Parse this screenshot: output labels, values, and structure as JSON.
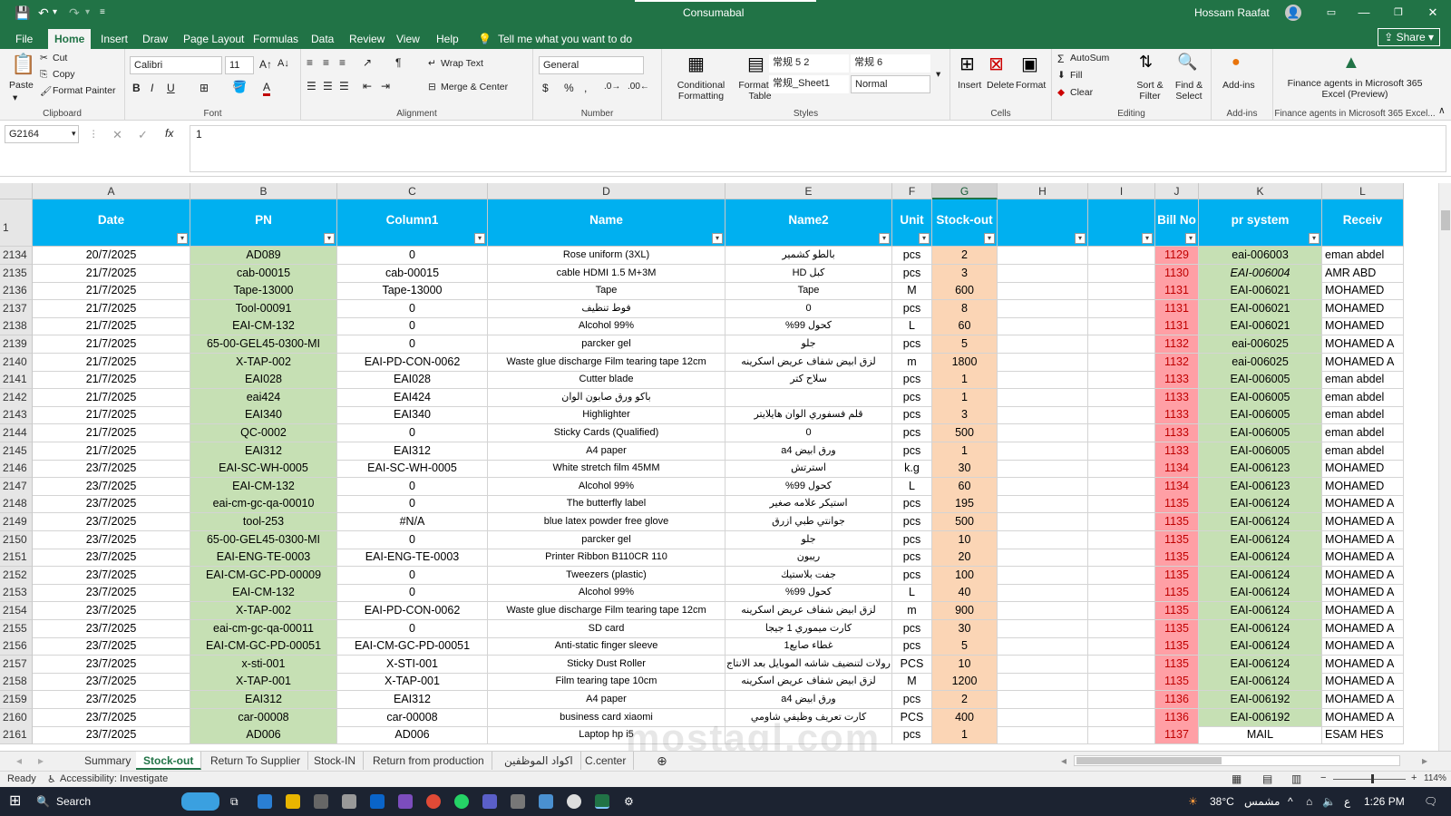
{
  "window": {
    "title": "Consumabal",
    "user": "Hossam Raafat"
  },
  "ribbon_tabs": [
    "File",
    "Home",
    "Insert",
    "Draw",
    "Page Layout",
    "Formulas",
    "Data",
    "Review",
    "View",
    "Help"
  ],
  "tell_me": "Tell me what you want to do",
  "share_label": "Share",
  "ribbon": {
    "clipboard": {
      "paste": "Paste",
      "cut": "Cut",
      "copy": "Copy",
      "format_painter": "Format Painter",
      "label": "Clipboard"
    },
    "font": {
      "name": "Calibri",
      "size": "11",
      "label": "Font"
    },
    "alignment": {
      "wrap": "Wrap Text",
      "merge": "Merge & Center",
      "label": "Alignment"
    },
    "number": {
      "format": "General",
      "label": "Number"
    },
    "styles": {
      "cond": "Conditional Formatting",
      "fmt_table": "Format as Table",
      "s1": "常规 5 2",
      "s2": "常规 6",
      "s3": "常规_Sheet1",
      "s4": "Normal",
      "label": "Styles"
    },
    "cells": {
      "insert": "Insert",
      "delete": "Delete",
      "format": "Format",
      "label": "Cells"
    },
    "editing": {
      "autosum": "AutoSum",
      "fill": "Fill",
      "clear": "Clear",
      "sort": "Sort & Filter",
      "find": "Find & Select",
      "label": "Editing"
    },
    "addins": {
      "addins": "Add-ins",
      "label": "Add-ins"
    },
    "finance": {
      "text": "Finance agents in Microsoft 365 Excel (Preview)",
      "label": "Finance agents in Microsoft 365 Excel..."
    }
  },
  "formula_bar": {
    "name_box": "G2164",
    "value": "1"
  },
  "columns": [
    "A",
    "B",
    "C",
    "D",
    "E",
    "F",
    "G",
    "H",
    "I",
    "J",
    "K",
    "L"
  ],
  "header_row_num": "1",
  "headers": [
    "Date",
    "PN",
    "Column1",
    "Name",
    "Name2",
    "Unit",
    "Stock-out",
    "",
    "",
    "Bill No",
    "pr system",
    "Receiv"
  ],
  "rows": [
    [
      "2134",
      "20/7/2025",
      "AD089",
      "0",
      "Rose uniform (3XL)",
      "بالطو كشمير",
      "pcs",
      "2",
      "1129",
      "eai-006003",
      "eman abdel"
    ],
    [
      "2135",
      "21/7/2025",
      "cab-00015",
      "cab-00015",
      "cable HDMI 1.5 M+3M",
      "كبل HD",
      "pcs",
      "3",
      "1130",
      "EAI-006004",
      "AMR ABD"
    ],
    [
      "2136",
      "21/7/2025",
      "Tape-13000",
      "Tape-13000",
      "Tape",
      "Tape",
      "M",
      "600",
      "1131",
      "EAI-006021",
      "MOHAMED"
    ],
    [
      "2137",
      "21/7/2025",
      "Tool-00091",
      "0",
      "فوط تنظيف",
      "0",
      "pcs",
      "8",
      "1131",
      "EAI-006021",
      "MOHAMED"
    ],
    [
      "2138",
      "21/7/2025",
      "EAI-CM-132",
      "0",
      "Alcohol 99%",
      "كحول 99%",
      "L",
      "60",
      "1131",
      "EAI-006021",
      "MOHAMED"
    ],
    [
      "2139",
      "21/7/2025",
      "65-00-GEL45-0300-MI",
      "0",
      "parcker gel",
      "جلو",
      "pcs",
      "5",
      "1132",
      "eai-006025",
      "MOHAMED A"
    ],
    [
      "2140",
      "21/7/2025",
      "X-TAP-002",
      "EAI-PD-CON-0062",
      "Waste glue discharge Film tearing tape 12cm",
      "لزق ابيض شفاف عريض اسكرينه",
      "m",
      "1800",
      "1132",
      "eai-006025",
      "MOHAMED A"
    ],
    [
      "2141",
      "21/7/2025",
      "EAI028",
      "EAI028",
      "Cutter blade",
      "سلاح كتر",
      "pcs",
      "1",
      "1133",
      "EAI-006005",
      "eman abdel"
    ],
    [
      "2142",
      "21/7/2025",
      "eai424",
      "EAI424",
      "باكو ورق صابون الوان",
      "",
      "pcs",
      "1",
      "1133",
      "EAI-006005",
      "eman abdel"
    ],
    [
      "2143",
      "21/7/2025",
      "EAI340",
      "EAI340",
      "Highlighter",
      "قلم فسفوري الوان هايلايتر",
      "pcs",
      "3",
      "1133",
      "EAI-006005",
      "eman abdel"
    ],
    [
      "2144",
      "21/7/2025",
      "QC-0002",
      "0",
      "Sticky Cards (Qualified)",
      "0",
      "pcs",
      "500",
      "1133",
      "EAI-006005",
      "eman abdel"
    ],
    [
      "2145",
      "21/7/2025",
      "EAI312",
      "EAI312",
      "A4 paper",
      "ورق ابيض a4",
      "pcs",
      "1",
      "1133",
      "EAI-006005",
      "eman abdel"
    ],
    [
      "2146",
      "23/7/2025",
      "EAI-SC-WH-0005",
      "EAI-SC-WH-0005",
      "White stretch film 45MM",
      "استرتش",
      "k.g",
      "30",
      "1134",
      "EAI-006123",
      "MOHAMED"
    ],
    [
      "2147",
      "23/7/2025",
      "EAI-CM-132",
      "0",
      "Alcohol 99%",
      "كحول 99%",
      "L",
      "60",
      "1134",
      "EAI-006123",
      "MOHAMED"
    ],
    [
      "2148",
      "23/7/2025",
      "eai-cm-gc-qa-00010",
      "0",
      "The butterfly label",
      "استيكر علامه صغير",
      "pcs",
      "195",
      "1135",
      "EAI-006124",
      "MOHAMED A"
    ],
    [
      "2149",
      "23/7/2025",
      "tool-253",
      "#N/A",
      "blue latex powder free glove",
      "جوانتي طبي ازرق",
      "pcs",
      "500",
      "1135",
      "EAI-006124",
      "MOHAMED A"
    ],
    [
      "2150",
      "23/7/2025",
      "65-00-GEL45-0300-MI",
      "0",
      "parcker gel",
      "جلو",
      "pcs",
      "10",
      "1135",
      "EAI-006124",
      "MOHAMED A"
    ],
    [
      "2151",
      "23/7/2025",
      "EAI-ENG-TE-0003",
      "EAI-ENG-TE-0003",
      "Printer Ribbon B110CR 110",
      "ريبون",
      "pcs",
      "20",
      "1135",
      "EAI-006124",
      "MOHAMED A"
    ],
    [
      "2152",
      "23/7/2025",
      "EAI-CM-GC-PD-00009",
      "0",
      "Tweezers (plastic)",
      "جفت بلاستيك",
      "pcs",
      "100",
      "1135",
      "EAI-006124",
      "MOHAMED A"
    ],
    [
      "2153",
      "23/7/2025",
      "EAI-CM-132",
      "0",
      "Alcohol 99%",
      "كحول 99%",
      "L",
      "40",
      "1135",
      "EAI-006124",
      "MOHAMED A"
    ],
    [
      "2154",
      "23/7/2025",
      "X-TAP-002",
      "EAI-PD-CON-0062",
      "Waste glue discharge Film tearing tape 12cm",
      "لزق ابيض شفاف عريض اسكرينه",
      "m",
      "900",
      "1135",
      "EAI-006124",
      "MOHAMED A"
    ],
    [
      "2155",
      "23/7/2025",
      "eai-cm-gc-qa-00011",
      "0",
      "SD card",
      "كارت ميموري 1 جيجا",
      "pcs",
      "30",
      "1135",
      "EAI-006124",
      "MOHAMED A"
    ],
    [
      "2156",
      "23/7/2025",
      "EAI-CM-GC-PD-00051",
      "EAI-CM-GC-PD-00051",
      "Anti-static finger sleeve",
      "غطاء صابع1",
      "pcs",
      "5",
      "1135",
      "EAI-006124",
      "MOHAMED A"
    ],
    [
      "2157",
      "23/7/2025",
      "x-sti-001",
      "X-STI-001",
      "Sticky Dust Roller",
      "رولات لتنضيف شاشه الموبايل بعد الانتاج",
      "PCS",
      "10",
      "1135",
      "EAI-006124",
      "MOHAMED A"
    ],
    [
      "2158",
      "23/7/2025",
      "X-TAP-001",
      "X-TAP-001",
      "Film tearing tape 10cm",
      "لزق ابيض شفاف عريض اسكرينه",
      "M",
      "1200",
      "1135",
      "EAI-006124",
      "MOHAMED A"
    ],
    [
      "2159",
      "23/7/2025",
      "EAI312",
      "EAI312",
      "A4 paper",
      "ورق ابيض a4",
      "pcs",
      "2",
      "1136",
      "EAI-006192",
      "MOHAMED A"
    ],
    [
      "2160",
      "23/7/2025",
      "car-00008",
      "car-00008",
      "business card xiaomi",
      "كارت تعريف وظيفي شاومي",
      "PCS",
      "400",
      "1136",
      "EAI-006192",
      "MOHAMED A"
    ],
    [
      "2161",
      "23/7/2025",
      "AD006",
      "AD006",
      "Laptop hp i5",
      "",
      "pcs",
      "1",
      "1137",
      "MAIL",
      "ESAM HES"
    ]
  ],
  "sheet_tabs": [
    "Summary",
    "Stock-out",
    "Return To Supplier",
    "Stock-IN",
    "Return from production",
    "اكواد الموظفين",
    "C.center"
  ],
  "active_sheet": "Stock-out",
  "status": {
    "ready": "Ready",
    "accessibility": "Accessibility: Investigate",
    "zoom": "114%"
  },
  "taskbar": {
    "search": "Search",
    "temp": "38°C",
    "weather": "مشمس",
    "time": "1:26 PM",
    "lang": "ع"
  },
  "watermark": "mostaql.com",
  "colors": {
    "excel_green": "#217346",
    "header_blue": "#00b0f0",
    "pn_green": "#c6e0b4",
    "bill_red": "#ff9fa5",
    "stock_orange": "#fbd5b5"
  }
}
